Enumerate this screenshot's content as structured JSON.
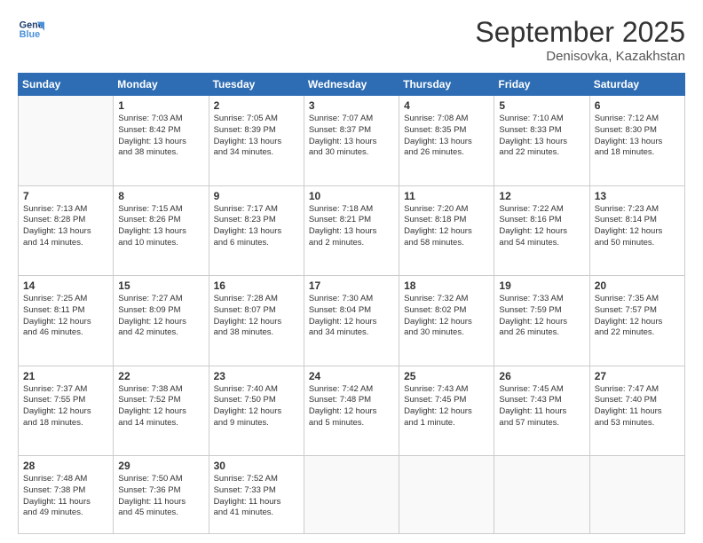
{
  "logo": {
    "line1": "General",
    "line2": "Blue"
  },
  "title": "September 2025",
  "subtitle": "Denisovka, Kazakhstan",
  "weekdays": [
    "Sunday",
    "Monday",
    "Tuesday",
    "Wednesday",
    "Thursday",
    "Friday",
    "Saturday"
  ],
  "weeks": [
    [
      {
        "day": "",
        "info": ""
      },
      {
        "day": "1",
        "info": "Sunrise: 7:03 AM\nSunset: 8:42 PM\nDaylight: 13 hours\nand 38 minutes."
      },
      {
        "day": "2",
        "info": "Sunrise: 7:05 AM\nSunset: 8:39 PM\nDaylight: 13 hours\nand 34 minutes."
      },
      {
        "day": "3",
        "info": "Sunrise: 7:07 AM\nSunset: 8:37 PM\nDaylight: 13 hours\nand 30 minutes."
      },
      {
        "day": "4",
        "info": "Sunrise: 7:08 AM\nSunset: 8:35 PM\nDaylight: 13 hours\nand 26 minutes."
      },
      {
        "day": "5",
        "info": "Sunrise: 7:10 AM\nSunset: 8:33 PM\nDaylight: 13 hours\nand 22 minutes."
      },
      {
        "day": "6",
        "info": "Sunrise: 7:12 AM\nSunset: 8:30 PM\nDaylight: 13 hours\nand 18 minutes."
      }
    ],
    [
      {
        "day": "7",
        "info": "Sunrise: 7:13 AM\nSunset: 8:28 PM\nDaylight: 13 hours\nand 14 minutes."
      },
      {
        "day": "8",
        "info": "Sunrise: 7:15 AM\nSunset: 8:26 PM\nDaylight: 13 hours\nand 10 minutes."
      },
      {
        "day": "9",
        "info": "Sunrise: 7:17 AM\nSunset: 8:23 PM\nDaylight: 13 hours\nand 6 minutes."
      },
      {
        "day": "10",
        "info": "Sunrise: 7:18 AM\nSunset: 8:21 PM\nDaylight: 13 hours\nand 2 minutes."
      },
      {
        "day": "11",
        "info": "Sunrise: 7:20 AM\nSunset: 8:18 PM\nDaylight: 12 hours\nand 58 minutes."
      },
      {
        "day": "12",
        "info": "Sunrise: 7:22 AM\nSunset: 8:16 PM\nDaylight: 12 hours\nand 54 minutes."
      },
      {
        "day": "13",
        "info": "Sunrise: 7:23 AM\nSunset: 8:14 PM\nDaylight: 12 hours\nand 50 minutes."
      }
    ],
    [
      {
        "day": "14",
        "info": "Sunrise: 7:25 AM\nSunset: 8:11 PM\nDaylight: 12 hours\nand 46 minutes."
      },
      {
        "day": "15",
        "info": "Sunrise: 7:27 AM\nSunset: 8:09 PM\nDaylight: 12 hours\nand 42 minutes."
      },
      {
        "day": "16",
        "info": "Sunrise: 7:28 AM\nSunset: 8:07 PM\nDaylight: 12 hours\nand 38 minutes."
      },
      {
        "day": "17",
        "info": "Sunrise: 7:30 AM\nSunset: 8:04 PM\nDaylight: 12 hours\nand 34 minutes."
      },
      {
        "day": "18",
        "info": "Sunrise: 7:32 AM\nSunset: 8:02 PM\nDaylight: 12 hours\nand 30 minutes."
      },
      {
        "day": "19",
        "info": "Sunrise: 7:33 AM\nSunset: 7:59 PM\nDaylight: 12 hours\nand 26 minutes."
      },
      {
        "day": "20",
        "info": "Sunrise: 7:35 AM\nSunset: 7:57 PM\nDaylight: 12 hours\nand 22 minutes."
      }
    ],
    [
      {
        "day": "21",
        "info": "Sunrise: 7:37 AM\nSunset: 7:55 PM\nDaylight: 12 hours\nand 18 minutes."
      },
      {
        "day": "22",
        "info": "Sunrise: 7:38 AM\nSunset: 7:52 PM\nDaylight: 12 hours\nand 14 minutes."
      },
      {
        "day": "23",
        "info": "Sunrise: 7:40 AM\nSunset: 7:50 PM\nDaylight: 12 hours\nand 9 minutes."
      },
      {
        "day": "24",
        "info": "Sunrise: 7:42 AM\nSunset: 7:48 PM\nDaylight: 12 hours\nand 5 minutes."
      },
      {
        "day": "25",
        "info": "Sunrise: 7:43 AM\nSunset: 7:45 PM\nDaylight: 12 hours\nand 1 minute."
      },
      {
        "day": "26",
        "info": "Sunrise: 7:45 AM\nSunset: 7:43 PM\nDaylight: 11 hours\nand 57 minutes."
      },
      {
        "day": "27",
        "info": "Sunrise: 7:47 AM\nSunset: 7:40 PM\nDaylight: 11 hours\nand 53 minutes."
      }
    ],
    [
      {
        "day": "28",
        "info": "Sunrise: 7:48 AM\nSunset: 7:38 PM\nDaylight: 11 hours\nand 49 minutes."
      },
      {
        "day": "29",
        "info": "Sunrise: 7:50 AM\nSunset: 7:36 PM\nDaylight: 11 hours\nand 45 minutes."
      },
      {
        "day": "30",
        "info": "Sunrise: 7:52 AM\nSunset: 7:33 PM\nDaylight: 11 hours\nand 41 minutes."
      },
      {
        "day": "",
        "info": ""
      },
      {
        "day": "",
        "info": ""
      },
      {
        "day": "",
        "info": ""
      },
      {
        "day": "",
        "info": ""
      }
    ]
  ]
}
